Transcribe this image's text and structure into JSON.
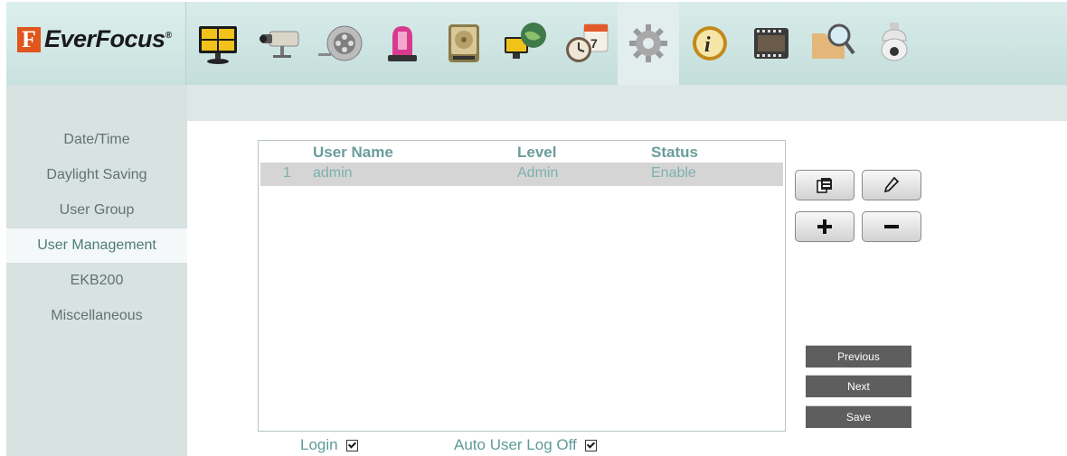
{
  "brand": {
    "logo_letter": "F",
    "name": "EverFocus",
    "mark": "®"
  },
  "toolbar": {
    "icons": [
      "monitor-grid-icon",
      "camera-icon",
      "film-reel-icon",
      "alarm-light-icon",
      "hard-disk-icon",
      "network-globe-icon",
      "schedule-clock-icon",
      "gear-icon",
      "info-icon",
      "film-strip-icon",
      "search-folder-icon",
      "ptz-dome-icon"
    ],
    "active": "gear-icon"
  },
  "sidebar": {
    "items": [
      {
        "label": "Date/Time"
      },
      {
        "label": "Daylight Saving"
      },
      {
        "label": "User Group"
      },
      {
        "label": "User Management"
      },
      {
        "label": "EKB200"
      },
      {
        "label": "Miscellaneous"
      }
    ],
    "active": "User Management"
  },
  "table": {
    "columns": [
      "User Name",
      "Level",
      "Status"
    ],
    "rows": [
      {
        "index": "1",
        "user": "admin",
        "level": "Admin",
        "status": "Enable"
      }
    ]
  },
  "actions": {
    "copy": "copy-icon",
    "edit": "pencil-icon",
    "add": "plus-icon",
    "remove": "minus-icon"
  },
  "nav": {
    "previous": "Previous",
    "next": "Next",
    "save": "Save"
  },
  "options": {
    "login": {
      "label": "Login",
      "checked": true
    },
    "auto_logoff": {
      "label": "Auto User Log Off",
      "checked": true
    }
  },
  "colors": {
    "accent_text": "#6a9d9b",
    "sidebar_bg": "#d7e2e1",
    "header_bg": "#c9e2df",
    "button_dark": "#5e5e5e"
  }
}
